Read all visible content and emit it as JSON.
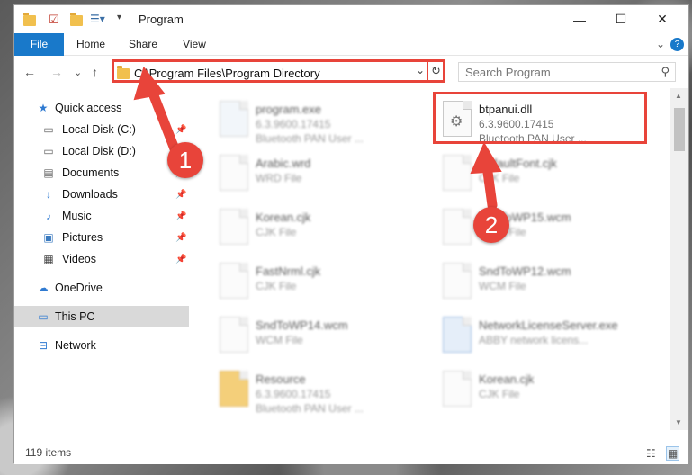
{
  "window": {
    "title": "Program",
    "buttons": {
      "minimize": "—",
      "maximize": "☐",
      "close": "✕"
    }
  },
  "ribbon": {
    "tabs": [
      {
        "label": "File",
        "active": true
      },
      {
        "label": "Home"
      },
      {
        "label": "Share"
      },
      {
        "label": "View"
      }
    ],
    "expand": "⌄",
    "help": "?"
  },
  "address": {
    "path": "C:\\Program Files\\Program Directory",
    "search_placeholder": "Search Program"
  },
  "nav": {
    "back": "←",
    "forward": "→",
    "recent": "⌄",
    "up": "↑",
    "dropdown": "⌄",
    "refresh": "↻"
  },
  "sidebar": {
    "items": [
      {
        "label": "Quick access",
        "icon": "star-icon",
        "pinned": false
      },
      {
        "label": "Local Disk (C:)",
        "icon": "drive-icon",
        "pinned": true
      },
      {
        "label": "Local Disk (D:)",
        "icon": "drive-icon",
        "pinned": false
      },
      {
        "label": "Documents",
        "icon": "document-icon",
        "pinned": true
      },
      {
        "label": "Downloads",
        "icon": "download-icon",
        "pinned": true
      },
      {
        "label": "Music",
        "icon": "music-icon",
        "pinned": true
      },
      {
        "label": "Pictures",
        "icon": "picture-icon",
        "pinned": true
      },
      {
        "label": "Videos",
        "icon": "video-icon",
        "pinned": true
      },
      {
        "label": "OneDrive",
        "icon": "cloud-icon",
        "pinned": false
      },
      {
        "label": "This PC",
        "icon": "computer-icon",
        "pinned": false,
        "selected": true
      },
      {
        "label": "Network",
        "icon": "network-icon",
        "pinned": false
      }
    ],
    "pin_glyph": "📌"
  },
  "files": [
    {
      "name": "program.exe",
      "type": "6.3.9600.17415",
      "desc": "Bluetooth PAN User ..."
    },
    {
      "name": "btpanui.dll",
      "type": "6.3.9600.17415",
      "desc": "Bluetooth PAN User ..."
    },
    {
      "name": "Arabic.wrd",
      "type": "WRD File",
      "desc": ""
    },
    {
      "name": "DefaultFont.cjk",
      "type": "CJK File",
      "desc": ""
    },
    {
      "name": "Korean.cjk",
      "type": "CJK File",
      "desc": ""
    },
    {
      "name": "SndToWP15.wcm",
      "type": "WCM File",
      "desc": ""
    },
    {
      "name": "FastNrml.cjk",
      "type": "CJK File",
      "desc": ""
    },
    {
      "name": "SndToWP12.wcm",
      "type": "WCM File",
      "desc": ""
    },
    {
      "name": "SndToWP14.wcm",
      "type": "WCM File",
      "desc": ""
    },
    {
      "name": "NetworkLicenseServer.exe",
      "type": "ABBY network licens...",
      "desc": ""
    },
    {
      "name": "Resource",
      "type": "6.3.9600.17415",
      "desc": "Bluetooth PAN User ..."
    },
    {
      "name": "Korean.cjk",
      "type": "CJK File",
      "desc": ""
    }
  ],
  "status": {
    "count": "119 items"
  },
  "annotations": {
    "step1": "1",
    "step2": "2",
    "color": "#e8443a"
  }
}
